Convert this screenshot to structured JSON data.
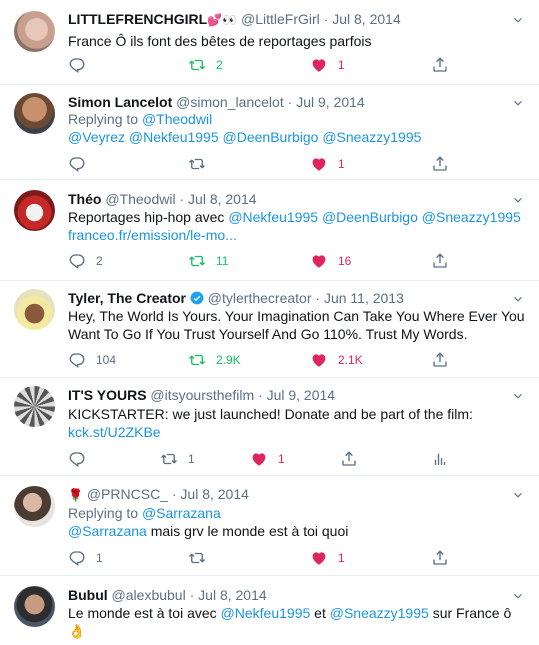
{
  "colors": {
    "link": "#1b95e0",
    "retweet": "#17bf63",
    "like": "#e0245e",
    "muted": "#5b7083",
    "border": "#e6ecf0"
  },
  "tweets": [
    {
      "name": "LITTLEFRENCHGIRL",
      "name_emoji": "💕👀",
      "handle": "@LittleFrGirl",
      "date": "Jul 8, 2014",
      "text": "France Ô ils font des bêtes de reportages parfois",
      "replies": "",
      "retweets": "2",
      "likes": "1"
    },
    {
      "name": "Simon Lancelot",
      "handle": "@simon_lancelot",
      "date": "Jul 9, 2014",
      "replying_prefix": "Replying to",
      "replying_to": "@Theodwil",
      "mentions": [
        "@Veyrez",
        "@Nekfeu1995",
        "@DeenBurbigo",
        "@Sneazzy1995"
      ],
      "replies": "",
      "retweets": "",
      "likes": "1"
    },
    {
      "name": "Théo",
      "handle": "@Theodwil",
      "date": "Jul 8, 2014",
      "text": "Reportages hip-hop avec",
      "mentions": [
        "@Nekfeu1995",
        "@DeenBurbigo",
        "@Sneazzy1995"
      ],
      "link": "franceo.fr/emission/le-mo...",
      "replies": "2",
      "retweets": "11",
      "likes": "16"
    },
    {
      "name": "Tyler, The Creator",
      "handle": "@tylerthecreator",
      "date": "Jun 11, 2013",
      "verified": true,
      "text": "Hey, The World Is Yours. Your Imagination Can Take You Where Ever You Want To Go If You Trust Yourself And Go 110%. Trust My Words.",
      "replies": "104",
      "retweets": "2.9K",
      "likes": "2.1K"
    },
    {
      "name": "IT'S YOURS",
      "handle": "@itsyoursthefilm",
      "date": "Jul 9, 2014",
      "text": "KICKSTARTER: we just launched! Donate and be part of the film:",
      "link": "kck.st/U2ZKBe",
      "replies": "",
      "retweets": "1",
      "likes": "1"
    },
    {
      "name": "🌹",
      "handle": "@PRNCSC_",
      "date": "Jul 8, 2014",
      "replying_prefix": "Replying to",
      "replying_to": "@Sarrazana",
      "mention": "@Sarrazana",
      "text": "mais grv le monde est à toi quoi",
      "replies": "1",
      "retweets": "",
      "likes": "1"
    },
    {
      "name": "Bubul",
      "handle": "@alexbubul",
      "date": "Jul 8, 2014",
      "text_a": "Le monde est à toi avec",
      "mention_a": "@Nekfeu1995",
      "text_b": "et",
      "mention_b": "@Sneazzy1995",
      "text_c": "sur France ô",
      "emoji": "👌"
    }
  ],
  "separator": " · "
}
